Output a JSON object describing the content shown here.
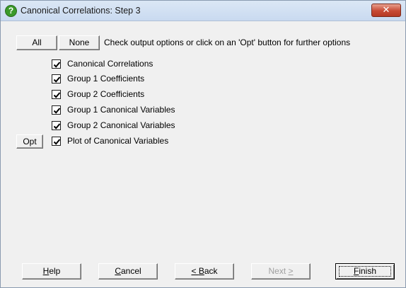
{
  "window": {
    "title": "Canonical Correlations: Step 3",
    "close_label": "✕"
  },
  "toolbar": {
    "all_label": "All",
    "none_label": "None",
    "instruction": "Check output options or click on an 'Opt' button for further options"
  },
  "options": [
    {
      "label": "Canonical Correlations",
      "checked": true
    },
    {
      "label": "Group 1 Coefficients",
      "checked": true
    },
    {
      "label": "Group 2 Coefficients",
      "checked": true
    },
    {
      "label": "Group 1 Canonical Variables",
      "checked": true
    },
    {
      "label": "Group 2 Canonical Variables",
      "checked": true
    },
    {
      "label": "Plot of Canonical Variables",
      "checked": true
    }
  ],
  "opt_button_label": "Opt",
  "footer": {
    "help": {
      "label": "Help",
      "mnemonic": "H",
      "rest": "elp"
    },
    "cancel": {
      "label": "Cancel",
      "mnemonic": "C",
      "rest": "ancel"
    },
    "back": {
      "label": "< Back",
      "prefix": "< ",
      "mnemonic": "B",
      "rest": "ack"
    },
    "next": {
      "label": "Next >",
      "prefix": "Next ",
      "suffix": ">"
    },
    "finish": {
      "label": "Finish",
      "mnemonic": "F",
      "rest": "inish"
    }
  },
  "icons": {
    "title": "help-question-icon"
  }
}
